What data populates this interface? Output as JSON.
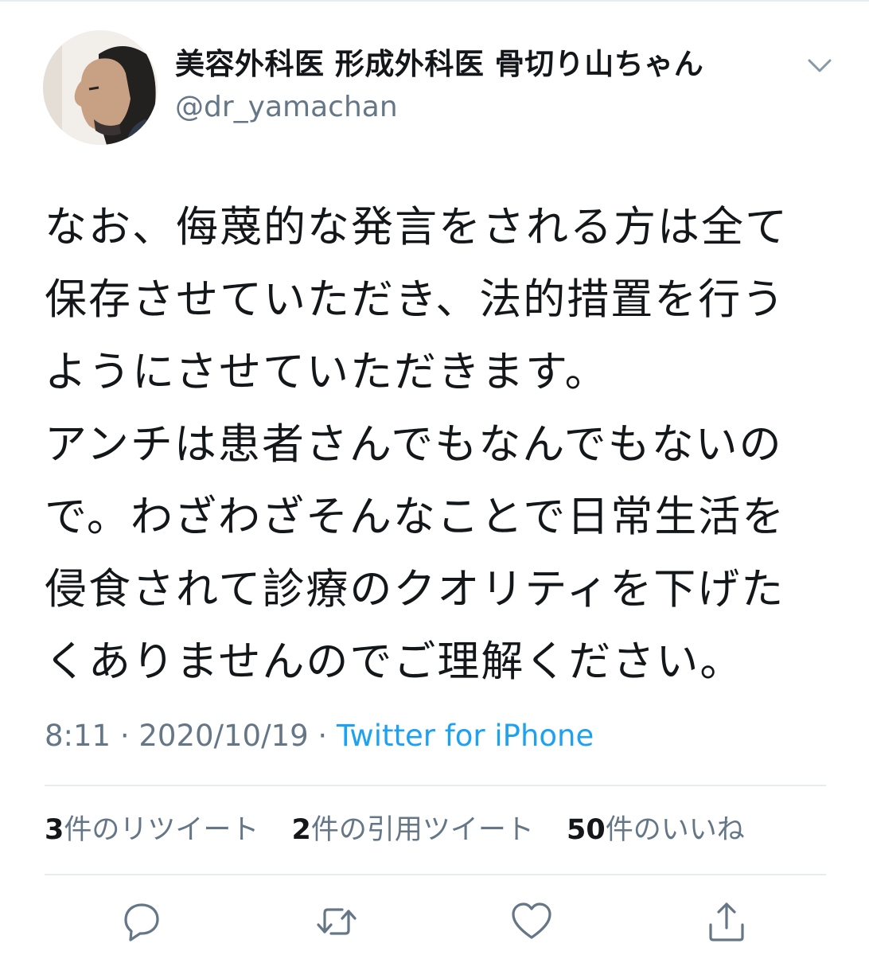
{
  "tweet": {
    "display_name": "美容外科医 形成外科医 骨切り山ちゃん",
    "handle": "@dr_yamachan",
    "text_lines": [
      "なお、侮蔑的な発言をされる方は全て",
      "保存させていただき、法的措置を行う",
      "ようにさせていただきます。",
      "アンチは患者さんでもなんでもないの",
      "で。わざわざそんなことで日常生活を",
      "侵食されて診療のクオリティを下げた",
      "くありませんのでご理解ください。"
    ],
    "time": "8:11",
    "date": "2020/10/19",
    "separator": "·",
    "source": "Twitter for iPhone"
  },
  "stats": {
    "retweets": {
      "count": "3",
      "label": "件のリツイート"
    },
    "quotes": {
      "count": "2",
      "label": "件の引用ツイート"
    },
    "likes": {
      "count": "50",
      "label": "件のいいね"
    }
  },
  "icons": {
    "menu": "chevron-down-icon",
    "reply": "reply-icon",
    "retweet": "retweet-icon",
    "like": "heart-icon",
    "share": "share-icon"
  },
  "colors": {
    "text": "#14171a",
    "secondary": "#657786",
    "link": "#1da1f2",
    "divider": "#e6ecf0"
  }
}
